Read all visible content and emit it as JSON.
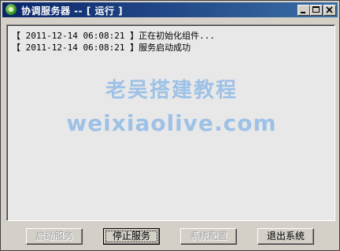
{
  "window": {
    "title": "协调服务器 -- [ 运行 ]"
  },
  "log": {
    "entries": [
      "【 2011-12-14 06:08:21 】正在初始化组件...",
      "【 2011-12-14 06:08:21 】服务启动成功"
    ]
  },
  "watermark": {
    "line1": "老吴搭建教程",
    "line2": "weixiaolive.com"
  },
  "buttons": {
    "start": "启动服务",
    "stop": "停止服务",
    "config": "系统配置",
    "exit": "退出系统"
  }
}
